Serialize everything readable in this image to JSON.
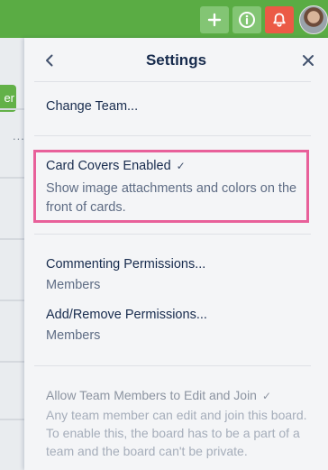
{
  "board": {
    "button_fragment": "er",
    "dots": "..."
  },
  "settings": {
    "title": "Settings",
    "change_team": "Change Team...",
    "card_covers": {
      "label": "Card Covers Enabled",
      "check": "✓",
      "description": "Show image attachments and colors on the front of cards."
    },
    "commenting": {
      "label": "Commenting Permissions...",
      "value": "Members"
    },
    "add_remove": {
      "label": "Add/Remove Permissions...",
      "value": "Members"
    },
    "allow_team": {
      "label": "Allow Team Members to Edit and Join",
      "check": "✓",
      "description": "Any team member can edit and join this board. To enable this, the board has to be a part of a team and the board can't be private."
    }
  },
  "colors": {
    "header_green": "#5aac44",
    "notification_red": "#eb5a46",
    "highlight_pink": "#e8609a"
  },
  "icons": {
    "add": "plus-icon",
    "info": "info-icon",
    "notifications": "bell-icon",
    "back": "chevron-left-icon",
    "close": "close-icon",
    "check": "checkmark-icon"
  }
}
